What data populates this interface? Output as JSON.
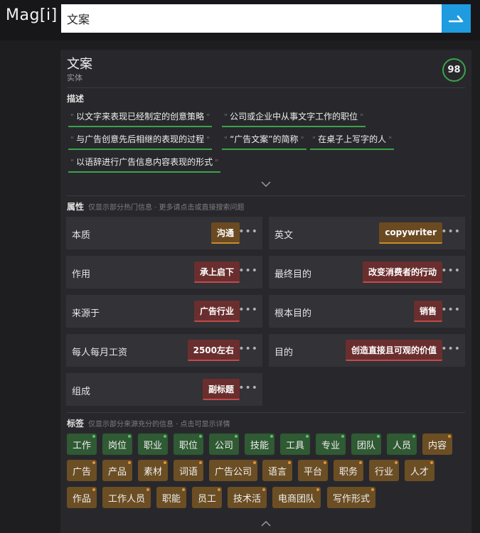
{
  "header": {
    "logo": "Mag[i]",
    "search_value": "文案"
  },
  "entity": {
    "name": "文案",
    "type": "实体",
    "score": "98"
  },
  "description": {
    "title": "描述",
    "items": [
      "以文字来表现已经制定的创意策略",
      "公司或企业中从事文字工作的职位",
      "与广告创意先后相继的表现的过程",
      "“广告文案”的简称",
      "在桌子上写字的人",
      "以语辞进行广告信息内容表现的形式"
    ]
  },
  "attributes": {
    "title": "属性",
    "hint": "仅显示部分热门信息 · 更多请点击或直接搜索问题",
    "more_icon": "ellipsis-icon",
    "items": [
      {
        "name": "本质",
        "value": "沟通",
        "color": "brown"
      },
      {
        "name": "英文",
        "value": "copywriter",
        "color": "brown"
      },
      {
        "name": "作用",
        "value": "承上启下",
        "color": "red"
      },
      {
        "name": "最终目的",
        "value": "改变消费者的行动",
        "color": "red"
      },
      {
        "name": "来源于",
        "value": "广告行业",
        "color": "red"
      },
      {
        "name": "根本目的",
        "value": "销售",
        "color": "red"
      },
      {
        "name": "每人每月工资",
        "value": "2500左右",
        "color": "red"
      },
      {
        "name": "目的",
        "value": "创造直接且可观的价值",
        "color": "red"
      },
      {
        "name": "组成",
        "value": "副标题",
        "color": "red"
      }
    ]
  },
  "tags": {
    "title": "标签",
    "hint": "仅显示部分来源充分的信息 · 点击可显示详情",
    "items": [
      {
        "label": "工作",
        "color": "green"
      },
      {
        "label": "岗位",
        "color": "green"
      },
      {
        "label": "职业",
        "color": "green"
      },
      {
        "label": "职位",
        "color": "green"
      },
      {
        "label": "公司",
        "color": "green"
      },
      {
        "label": "技能",
        "color": "green"
      },
      {
        "label": "工具",
        "color": "green"
      },
      {
        "label": "专业",
        "color": "green"
      },
      {
        "label": "团队",
        "color": "green"
      },
      {
        "label": "人员",
        "color": "green"
      },
      {
        "label": "内容",
        "color": "brown"
      },
      {
        "label": "广告",
        "color": "brown"
      },
      {
        "label": "产品",
        "color": "brown"
      },
      {
        "label": "素材",
        "color": "brown"
      },
      {
        "label": "词语",
        "color": "brown"
      },
      {
        "label": "广告公司",
        "color": "brown"
      },
      {
        "label": "语言",
        "color": "brown"
      },
      {
        "label": "平台",
        "color": "brown"
      },
      {
        "label": "职务",
        "color": "brown"
      },
      {
        "label": "行业",
        "color": "brown"
      },
      {
        "label": "人才",
        "color": "brown"
      },
      {
        "label": "作品",
        "color": "brown"
      },
      {
        "label": "工作人员",
        "color": "brown"
      },
      {
        "label": "职能",
        "color": "brown"
      },
      {
        "label": "员工",
        "color": "brown"
      },
      {
        "label": "技术活",
        "color": "brown"
      },
      {
        "label": "电商团队",
        "color": "brown"
      },
      {
        "label": "写作形式",
        "color": "brown"
      }
    ]
  },
  "colors": {
    "accent_blue": "#1f9be0",
    "green": "#3aa34a",
    "tag_green": "#2f5a33",
    "tag_brown": "#6b4e24",
    "attr_red": "#6a2e2e"
  }
}
